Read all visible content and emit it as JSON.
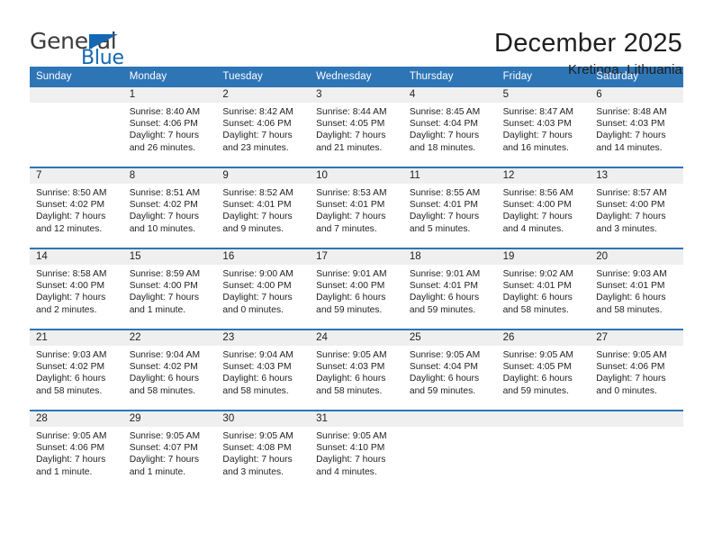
{
  "brand": {
    "name_top": "General",
    "name_bottom": "Blue",
    "triangle_color": "#1268b3",
    "text_color": "#3b3b3b"
  },
  "header": {
    "title": "December 2025",
    "subtitle": "Kretinga, Lithuania"
  },
  "theme": {
    "header_blue": "#2e75b6",
    "separator_blue": "#2e75b6",
    "day_band_gray": "#efefef",
    "text_dark": "#232323"
  },
  "weekdays": [
    "Sunday",
    "Monday",
    "Tuesday",
    "Wednesday",
    "Thursday",
    "Friday",
    "Saturday"
  ],
  "weeks": [
    [
      {
        "day": "",
        "sunrise": "",
        "sunset": "",
        "daylight": "",
        "empty": true
      },
      {
        "day": "1",
        "sunrise": "Sunrise: 8:40 AM",
        "sunset": "Sunset: 4:06 PM",
        "daylight": "Daylight: 7 hours and 26 minutes."
      },
      {
        "day": "2",
        "sunrise": "Sunrise: 8:42 AM",
        "sunset": "Sunset: 4:06 PM",
        "daylight": "Daylight: 7 hours and 23 minutes."
      },
      {
        "day": "3",
        "sunrise": "Sunrise: 8:44 AM",
        "sunset": "Sunset: 4:05 PM",
        "daylight": "Daylight: 7 hours and 21 minutes."
      },
      {
        "day": "4",
        "sunrise": "Sunrise: 8:45 AM",
        "sunset": "Sunset: 4:04 PM",
        "daylight": "Daylight: 7 hours and 18 minutes."
      },
      {
        "day": "5",
        "sunrise": "Sunrise: 8:47 AM",
        "sunset": "Sunset: 4:03 PM",
        "daylight": "Daylight: 7 hours and 16 minutes."
      },
      {
        "day": "6",
        "sunrise": "Sunrise: 8:48 AM",
        "sunset": "Sunset: 4:03 PM",
        "daylight": "Daylight: 7 hours and 14 minutes."
      }
    ],
    [
      {
        "day": "7",
        "sunrise": "Sunrise: 8:50 AM",
        "sunset": "Sunset: 4:02 PM",
        "daylight": "Daylight: 7 hours and 12 minutes."
      },
      {
        "day": "8",
        "sunrise": "Sunrise: 8:51 AM",
        "sunset": "Sunset: 4:02 PM",
        "daylight": "Daylight: 7 hours and 10 minutes."
      },
      {
        "day": "9",
        "sunrise": "Sunrise: 8:52 AM",
        "sunset": "Sunset: 4:01 PM",
        "daylight": "Daylight: 7 hours and 9 minutes."
      },
      {
        "day": "10",
        "sunrise": "Sunrise: 8:53 AM",
        "sunset": "Sunset: 4:01 PM",
        "daylight": "Daylight: 7 hours and 7 minutes."
      },
      {
        "day": "11",
        "sunrise": "Sunrise: 8:55 AM",
        "sunset": "Sunset: 4:01 PM",
        "daylight": "Daylight: 7 hours and 5 minutes."
      },
      {
        "day": "12",
        "sunrise": "Sunrise: 8:56 AM",
        "sunset": "Sunset: 4:00 PM",
        "daylight": "Daylight: 7 hours and 4 minutes."
      },
      {
        "day": "13",
        "sunrise": "Sunrise: 8:57 AM",
        "sunset": "Sunset: 4:00 PM",
        "daylight": "Daylight: 7 hours and 3 minutes."
      }
    ],
    [
      {
        "day": "14",
        "sunrise": "Sunrise: 8:58 AM",
        "sunset": "Sunset: 4:00 PM",
        "daylight": "Daylight: 7 hours and 2 minutes."
      },
      {
        "day": "15",
        "sunrise": "Sunrise: 8:59 AM",
        "sunset": "Sunset: 4:00 PM",
        "daylight": "Daylight: 7 hours and 1 minute."
      },
      {
        "day": "16",
        "sunrise": "Sunrise: 9:00 AM",
        "sunset": "Sunset: 4:00 PM",
        "daylight": "Daylight: 7 hours and 0 minutes."
      },
      {
        "day": "17",
        "sunrise": "Sunrise: 9:01 AM",
        "sunset": "Sunset: 4:00 PM",
        "daylight": "Daylight: 6 hours and 59 minutes."
      },
      {
        "day": "18",
        "sunrise": "Sunrise: 9:01 AM",
        "sunset": "Sunset: 4:01 PM",
        "daylight": "Daylight: 6 hours and 59 minutes."
      },
      {
        "day": "19",
        "sunrise": "Sunrise: 9:02 AM",
        "sunset": "Sunset: 4:01 PM",
        "daylight": "Daylight: 6 hours and 58 minutes."
      },
      {
        "day": "20",
        "sunrise": "Sunrise: 9:03 AM",
        "sunset": "Sunset: 4:01 PM",
        "daylight": "Daylight: 6 hours and 58 minutes."
      }
    ],
    [
      {
        "day": "21",
        "sunrise": "Sunrise: 9:03 AM",
        "sunset": "Sunset: 4:02 PM",
        "daylight": "Daylight: 6 hours and 58 minutes."
      },
      {
        "day": "22",
        "sunrise": "Sunrise: 9:04 AM",
        "sunset": "Sunset: 4:02 PM",
        "daylight": "Daylight: 6 hours and 58 minutes."
      },
      {
        "day": "23",
        "sunrise": "Sunrise: 9:04 AM",
        "sunset": "Sunset: 4:03 PM",
        "daylight": "Daylight: 6 hours and 58 minutes."
      },
      {
        "day": "24",
        "sunrise": "Sunrise: 9:05 AM",
        "sunset": "Sunset: 4:03 PM",
        "daylight": "Daylight: 6 hours and 58 minutes."
      },
      {
        "day": "25",
        "sunrise": "Sunrise: 9:05 AM",
        "sunset": "Sunset: 4:04 PM",
        "daylight": "Daylight: 6 hours and 59 minutes."
      },
      {
        "day": "26",
        "sunrise": "Sunrise: 9:05 AM",
        "sunset": "Sunset: 4:05 PM",
        "daylight": "Daylight: 6 hours and 59 minutes."
      },
      {
        "day": "27",
        "sunrise": "Sunrise: 9:05 AM",
        "sunset": "Sunset: 4:06 PM",
        "daylight": "Daylight: 7 hours and 0 minutes."
      }
    ],
    [
      {
        "day": "28",
        "sunrise": "Sunrise: 9:05 AM",
        "sunset": "Sunset: 4:06 PM",
        "daylight": "Daylight: 7 hours and 1 minute."
      },
      {
        "day": "29",
        "sunrise": "Sunrise: 9:05 AM",
        "sunset": "Sunset: 4:07 PM",
        "daylight": "Daylight: 7 hours and 1 minute."
      },
      {
        "day": "30",
        "sunrise": "Sunrise: 9:05 AM",
        "sunset": "Sunset: 4:08 PM",
        "daylight": "Daylight: 7 hours and 3 minutes."
      },
      {
        "day": "31",
        "sunrise": "Sunrise: 9:05 AM",
        "sunset": "Sunset: 4:10 PM",
        "daylight": "Daylight: 7 hours and 4 minutes."
      },
      {
        "day": "",
        "sunrise": "",
        "sunset": "",
        "daylight": "",
        "empty": true
      },
      {
        "day": "",
        "sunrise": "",
        "sunset": "",
        "daylight": "",
        "empty": true
      },
      {
        "day": "",
        "sunrise": "",
        "sunset": "",
        "daylight": "",
        "empty": true
      }
    ]
  ]
}
